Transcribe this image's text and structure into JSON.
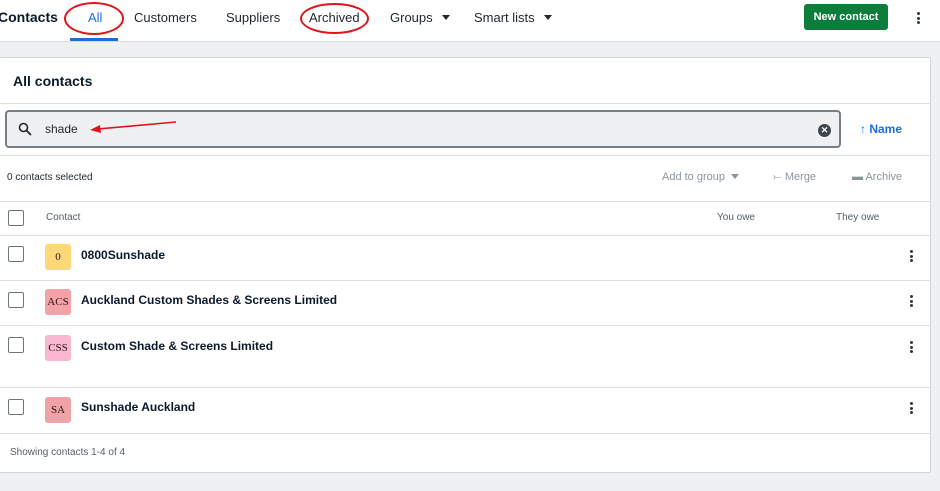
{
  "header": {
    "title": "Contacts",
    "tabs": [
      {
        "label": "All",
        "active": true
      },
      {
        "label": "Customers"
      },
      {
        "label": "Suppliers"
      },
      {
        "label": "Archived"
      },
      {
        "label": "Groups",
        "has_dropdown": true
      },
      {
        "label": "Smart lists",
        "has_dropdown": true
      }
    ],
    "new_contact_label": "New contact"
  },
  "card": {
    "title": "All contacts",
    "search": {
      "value": "shade",
      "placeholder": ""
    },
    "sort_label": "Name",
    "selected_count_text": "0 contacts selected",
    "actions": {
      "add_to_group": "Add to group",
      "merge": "Merge",
      "archive": "Archive"
    },
    "columns": {
      "contact": "Contact",
      "you_owe": "You owe",
      "they_owe": "They owe"
    },
    "contacts": [
      {
        "initials": "0",
        "name": "0800Sunshade",
        "avatar_color": "#fdd87a"
      },
      {
        "initials": "ACS",
        "name": "Auckland Custom Shades & Screens Limited",
        "avatar_color": "#f3a3a8"
      },
      {
        "initials": "CSS",
        "name": "Custom Shade & Screens Limited",
        "avatar_color": "#f9b8d0"
      },
      {
        "initials": "SA",
        "name": "Sunshade Auckland",
        "avatar_color": "#f0a3a6"
      }
    ],
    "footer": "Showing contacts 1-4 of 4"
  },
  "colors": {
    "accent": "#1c6ddc",
    "primary_button": "#0e7c3a",
    "annotation": "#e0141b"
  }
}
